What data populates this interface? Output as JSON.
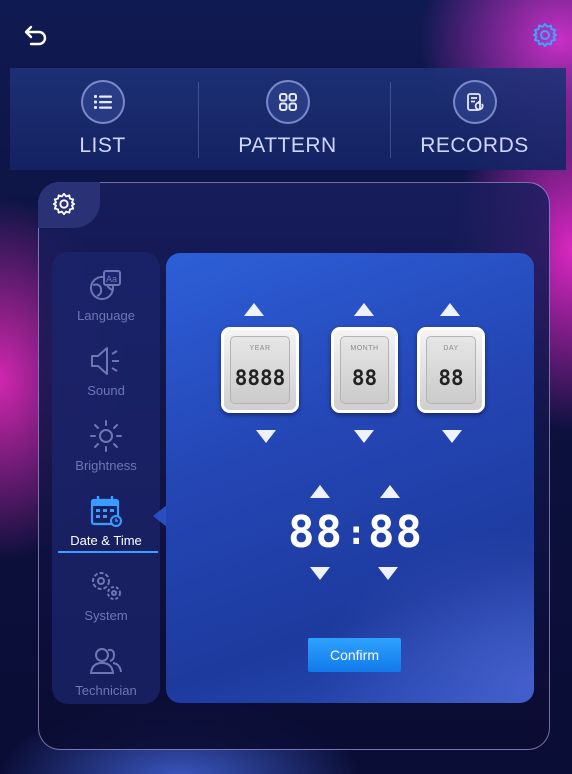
{
  "nav": {
    "tabs": [
      {
        "label": "LIST",
        "icon": "list-icon"
      },
      {
        "label": "PATTERN",
        "icon": "pattern-icon"
      },
      {
        "label": "RECORDS",
        "icon": "records-icon"
      }
    ]
  },
  "sidebar": {
    "items": [
      {
        "label": "Language",
        "icon": "language-icon"
      },
      {
        "label": "Sound",
        "icon": "speaker-icon"
      },
      {
        "label": "Brightness",
        "icon": "sun-icon"
      },
      {
        "label": "Date & Time",
        "icon": "calendar-icon",
        "active": true
      },
      {
        "label": "System",
        "icon": "gears-icon"
      },
      {
        "label": "Technician",
        "icon": "users-icon"
      }
    ]
  },
  "date": {
    "year": {
      "caption": "YEAR",
      "value": "8888"
    },
    "month": {
      "caption": "MONTH",
      "value": "88"
    },
    "day": {
      "caption": "DAY",
      "value": "88"
    }
  },
  "time": {
    "hours": "88",
    "separator": ":",
    "minutes": "88"
  },
  "confirm_label": "Confirm",
  "colors": {
    "accent": "#1e88f0",
    "active_line": "#3aa0ff",
    "content_bg": "#2446b5"
  }
}
